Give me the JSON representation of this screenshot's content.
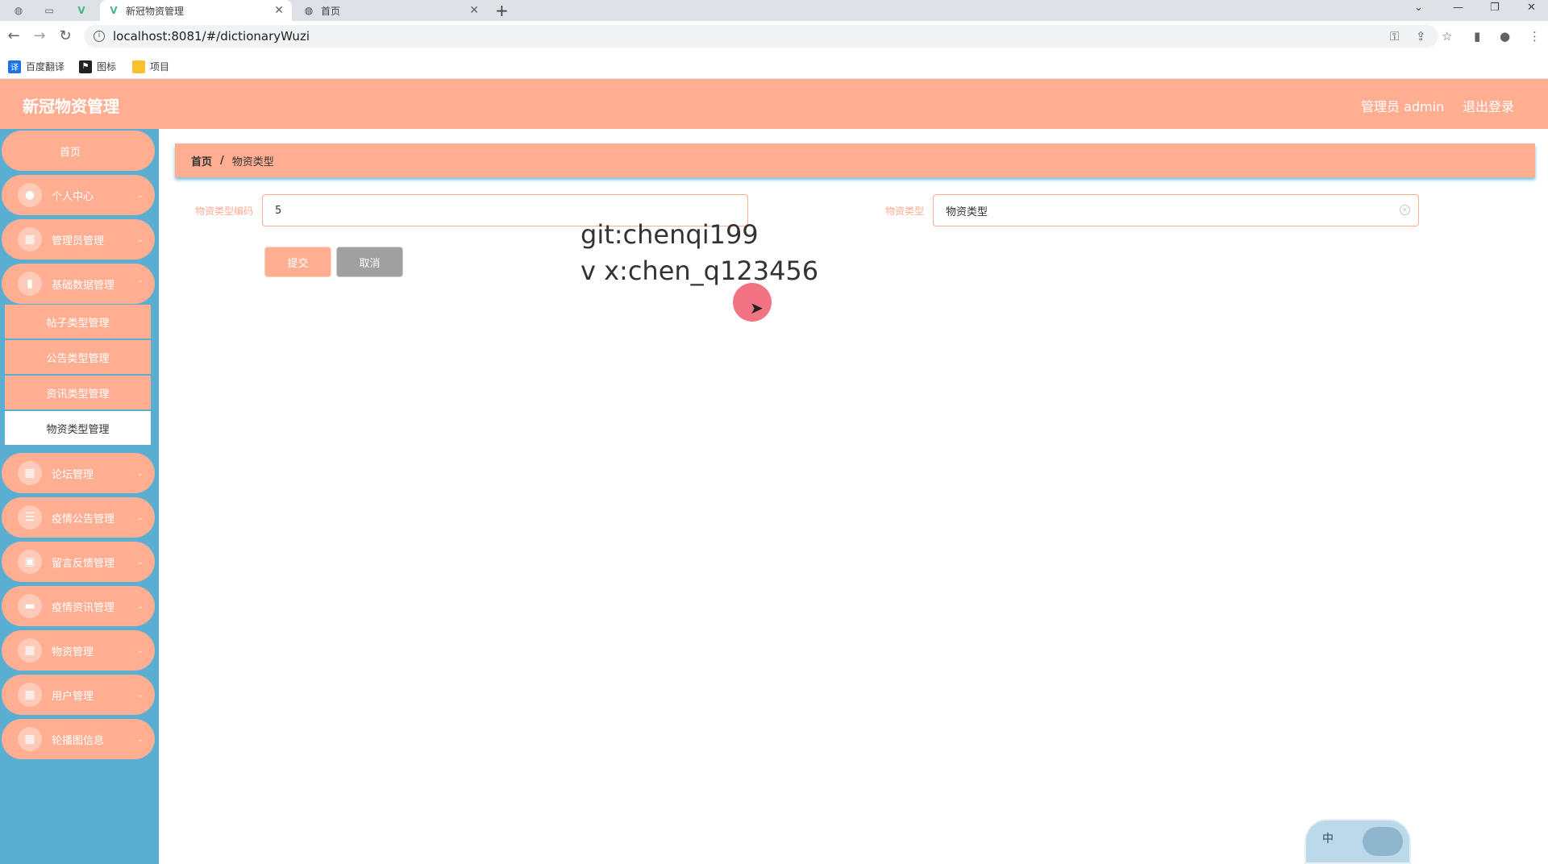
{
  "browser": {
    "tabs": [
      {
        "title": "新冠物资管理",
        "active": true
      },
      {
        "title": "首页",
        "active": false
      }
    ],
    "new_tab_glyph": "+",
    "url": "localhost:8081/#/dictionaryWuzi",
    "bookmarks": [
      {
        "label": "百度翻译",
        "icon": "translate-icon",
        "color": "#1a73e8"
      },
      {
        "label": "图标",
        "icon": "flag-icon",
        "color": "#202124"
      },
      {
        "label": "项目",
        "icon": "folder-icon",
        "color": "#fbc02d"
      }
    ]
  },
  "header": {
    "title": "新冠物资管理",
    "user": "管理员 admin",
    "logout": "退出登录",
    "color": "#ffae92"
  },
  "sidebar": {
    "color": "#5aaed2",
    "home": "首页",
    "items": [
      {
        "label": "个人中心",
        "icon": "user-icon"
      },
      {
        "label": "管理员管理",
        "icon": "grid-icon"
      },
      {
        "label": "基础数据管理",
        "icon": "bar-chart-icon"
      },
      {
        "label": "论坛管理",
        "icon": "grid-icon"
      },
      {
        "label": "疫情公告管理",
        "icon": "sliders-icon"
      },
      {
        "label": "留言反馈管理",
        "icon": "clipboard-icon"
      },
      {
        "label": "疫情资讯管理",
        "icon": "message-icon"
      },
      {
        "label": "物资管理",
        "icon": "grid-icon"
      },
      {
        "label": "用户管理",
        "icon": "grid-icon"
      },
      {
        "label": "轮播图信息",
        "icon": "grid-icon"
      }
    ],
    "submenu": [
      {
        "label": "帖子类型管理",
        "active": false
      },
      {
        "label": "公告类型管理",
        "active": false
      },
      {
        "label": "资讯类型管理",
        "active": false
      },
      {
        "label": "物资类型管理",
        "active": true
      }
    ]
  },
  "breadcrumb": {
    "home": "首页",
    "separator": "/",
    "current": "物资类型"
  },
  "form": {
    "code_label": "物资类型编码",
    "code_value": "5",
    "type_label": "物资类型",
    "type_value": "物资类型",
    "submit": "提交",
    "cancel": "取消"
  },
  "overlay": {
    "line1": "git:chenqi199",
    "line2": "v x:chen_q123456"
  },
  "ime": {
    "char": "中"
  }
}
